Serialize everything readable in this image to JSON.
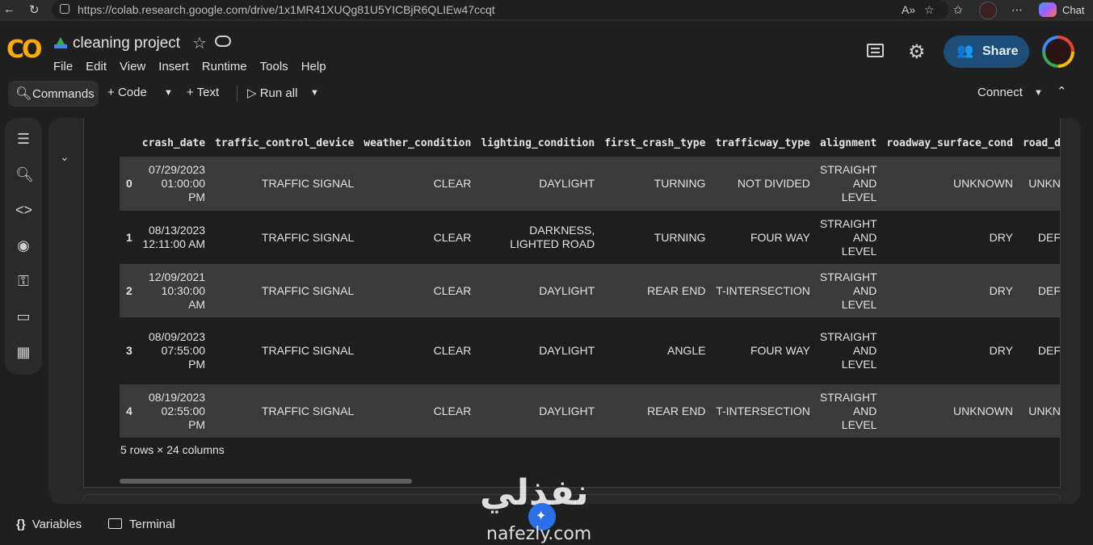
{
  "browser": {
    "url": "https://colab.research.google.com/drive/1x1MR41XUQg81U5YICBjR6QLIEw47ccqt",
    "chat_label": "Chat"
  },
  "header": {
    "logo": "CO",
    "title": "cleaning project",
    "menu": [
      "File",
      "Edit",
      "View",
      "Insert",
      "Runtime",
      "Tools",
      "Help"
    ],
    "share_label": "Share"
  },
  "toolbar": {
    "commands_label": "Commands",
    "code_label": "Code",
    "text_label": "Text",
    "run_all_label": "Run all",
    "connect_label": "Connect"
  },
  "table": {
    "columns": [
      "",
      "crash_date",
      "traffic_control_device",
      "weather_condition",
      "lighting_condition",
      "first_crash_type",
      "trafficway_type",
      "alignment",
      "roadway_surface_cond",
      "road_d"
    ],
    "rows": [
      [
        "0",
        "07/29/2023 01:00:00 PM",
        "TRAFFIC SIGNAL",
        "CLEAR",
        "DAYLIGHT",
        "TURNING",
        "NOT DIVIDED",
        "STRAIGHT AND LEVEL",
        "UNKNOWN",
        "UNKN"
      ],
      [
        "1",
        "08/13/2023 12:11:00 AM",
        "TRAFFIC SIGNAL",
        "CLEAR",
        "DARKNESS, LIGHTED ROAD",
        "TURNING",
        "FOUR WAY",
        "STRAIGHT AND LEVEL",
        "DRY",
        "DEF"
      ],
      [
        "2",
        "12/09/2021 10:30:00 AM",
        "TRAFFIC SIGNAL",
        "CLEAR",
        "DAYLIGHT",
        "REAR END",
        "T-INTERSECTION",
        "STRAIGHT AND LEVEL",
        "DRY",
        "DEF"
      ],
      [
        "3",
        "08/09/2023 07:55:00 PM",
        "TRAFFIC SIGNAL",
        "CLEAR",
        "DAYLIGHT",
        "ANGLE",
        "FOUR WAY",
        "STRAIGHT AND LEVEL",
        "DRY",
        "DEF"
      ],
      [
        "4",
        "08/19/2023 02:55:00 PM",
        "TRAFFIC SIGNAL",
        "CLEAR",
        "DAYLIGHT",
        "REAR END",
        "T-INTERSECTION",
        "STRAIGHT AND LEVEL",
        "UNKNOWN",
        "UNKN"
      ]
    ],
    "summary": "5 rows × 24 columns"
  },
  "bottom": {
    "variables_label": "Variables",
    "terminal_label": "Terminal"
  },
  "watermark": {
    "arabic": "نفذلي",
    "latin": "nafezly.com"
  },
  "colors": {
    "accent_orange": "#f9ab00",
    "share_bg": "#1d4e79",
    "background": "#1f1f1f",
    "row_stripe": "#3a3a3a"
  }
}
